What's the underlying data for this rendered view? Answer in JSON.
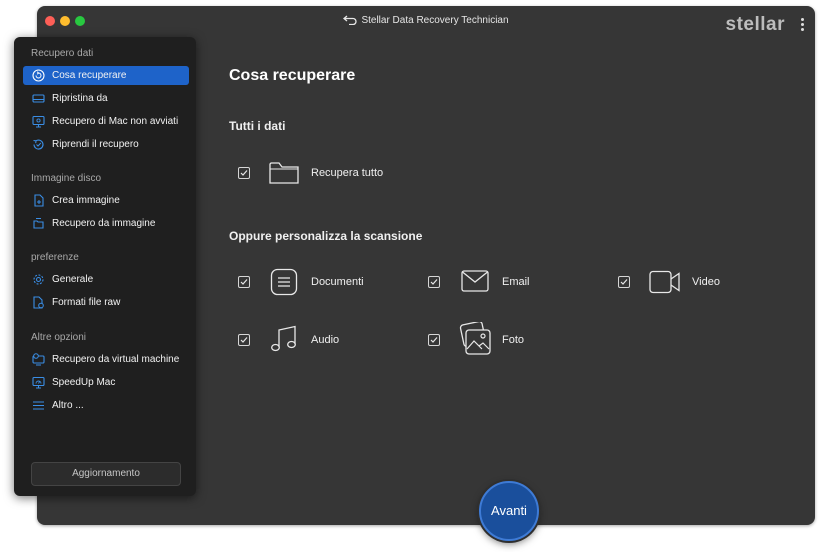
{
  "window": {
    "title": "Stellar Data Recovery Technician",
    "brand": "stellar"
  },
  "sidebar": {
    "sections": [
      {
        "heading": "Recupero dati",
        "items": [
          {
            "label": "Cosa recuperare",
            "icon": "recover-icon",
            "active": true
          },
          {
            "label": "Ripristina da",
            "icon": "drive-icon"
          },
          {
            "label": "Recupero di Mac non avviati",
            "icon": "monitor-icon"
          },
          {
            "label": "Riprendi il recupero",
            "icon": "resume-icon"
          }
        ]
      },
      {
        "heading": "Immagine disco",
        "items": [
          {
            "label": "Crea immagine",
            "icon": "create-image-icon"
          },
          {
            "label": "Recupero da immagine",
            "icon": "image-recovery-icon"
          }
        ]
      },
      {
        "heading": "preferenze",
        "items": [
          {
            "label": "Generale",
            "icon": "gear-icon"
          },
          {
            "label": "Formati file raw",
            "icon": "raw-file-icon"
          }
        ]
      },
      {
        "heading": "Altre opzioni",
        "items": [
          {
            "label": "Recupero da virtual machine",
            "icon": "virtual-machine-icon"
          },
          {
            "label": "SpeedUp Mac",
            "icon": "speedup-icon"
          },
          {
            "label": "Altro ...",
            "icon": "more-icon"
          }
        ]
      }
    ],
    "update_label": "Aggiornamento"
  },
  "main": {
    "title": "Cosa recuperare",
    "all_data_heading": "Tutti i dati",
    "recover_all": {
      "label": "Recupera tutto",
      "checked": true,
      "icon": "folder-icon"
    },
    "custom_heading": "Oppure personalizza la scansione",
    "options": [
      {
        "label": "Documenti",
        "checked": true,
        "icon": "document-icon"
      },
      {
        "label": "Email",
        "checked": true,
        "icon": "email-icon"
      },
      {
        "label": "Video",
        "checked": true,
        "icon": "video-icon"
      },
      {
        "label": "Audio",
        "checked": true,
        "icon": "audio-icon"
      },
      {
        "label": "Foto",
        "checked": true,
        "icon": "photo-icon"
      }
    ]
  },
  "next_label": "Avanti",
  "colors": {
    "accent": "#1e63c9",
    "window_bg": "#363636",
    "sidebar_bg": "#1f1f1f"
  }
}
